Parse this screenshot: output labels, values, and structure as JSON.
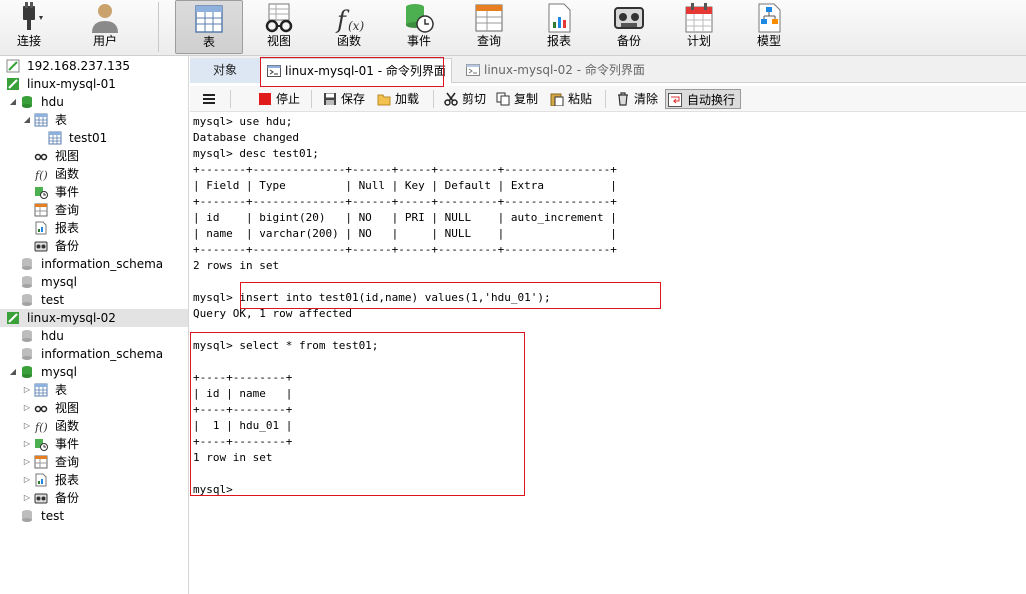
{
  "toolbar": {
    "connect": "连接",
    "user": "用户",
    "table": "表",
    "view": "视图",
    "function": "函数",
    "event": "事件",
    "query": "查询",
    "report": "报表",
    "backup": "备份",
    "schedule": "计划",
    "model": "模型",
    "active": "table"
  },
  "sidebar": {
    "items": [
      {
        "label": "192.168.237.135"
      },
      {
        "label": "linux-mysql-01"
      },
      {
        "label": "hdu"
      },
      {
        "label": "表"
      },
      {
        "label": "test01"
      },
      {
        "label": "视图"
      },
      {
        "label": "函数"
      },
      {
        "label": "事件"
      },
      {
        "label": "查询"
      },
      {
        "label": "报表"
      },
      {
        "label": "备份"
      },
      {
        "label": "information_schema"
      },
      {
        "label": "mysql"
      },
      {
        "label": "test"
      },
      {
        "label": "linux-mysql-02"
      },
      {
        "label": "hdu"
      },
      {
        "label": "information_schema"
      },
      {
        "label": "mysql"
      },
      {
        "label": "表"
      },
      {
        "label": "视图"
      },
      {
        "label": "函数"
      },
      {
        "label": "事件"
      },
      {
        "label": "查询"
      },
      {
        "label": "报表"
      },
      {
        "label": "备份"
      },
      {
        "label": "test"
      }
    ]
  },
  "tabs": {
    "objects": "对象",
    "tab1": "linux-mysql-01 - 命令列界面",
    "tab2": "linux-mysql-02 - 命令列界面"
  },
  "querybar": {
    "stop": "停止",
    "save": "保存",
    "load": "加载",
    "cut": "剪切",
    "copy": "复制",
    "paste": "粘贴",
    "clear": "清除",
    "wrap": "自动换行"
  },
  "console": {
    "lines": [
      "mysql> use hdu;",
      "Database changed",
      "mysql> desc test01;",
      "+-------+--------------+------+-----+---------+----------------+",
      "| Field | Type         | Null | Key | Default | Extra          |",
      "+-------+--------------+------+-----+---------+----------------+",
      "| id    | bigint(20)   | NO   | PRI | NULL    | auto_increment |",
      "| name  | varchar(200) | NO   |     | NULL    |                |",
      "+-------+--------------+------+-----+---------+----------------+",
      "2 rows in set",
      "",
      "mysql> insert into test01(id,name) values(1,'hdu_01');",
      "Query OK, 1 row affected",
      "",
      "mysql> select * from test01;",
      "",
      "+----+--------+",
      "| id | name   |",
      "+----+--------+",
      "|  1 | hdu_01 |",
      "+----+--------+",
      "1 row in set",
      "",
      "mysql>"
    ]
  },
  "colors": {
    "highlight_border": "#e0141e",
    "mysql_green": "#3aa13a",
    "selected_row": "#e3e3e3"
  }
}
